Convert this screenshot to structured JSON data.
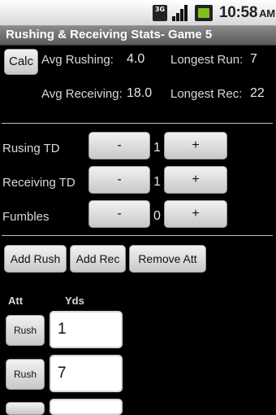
{
  "status_bar": {
    "network": "3G",
    "time": "10:58",
    "ampm": "AM"
  },
  "app": {
    "title": "Rushing & Receiving Stats- Game 5"
  },
  "summary": {
    "calc_label": "Calc",
    "avg_rushing_label": "Avg Rushing:",
    "avg_rushing_value": "4.0",
    "longest_run_label": "Longest Run:",
    "longest_run_value": "7",
    "avg_receiving_label": "Avg Receiving:",
    "avg_receiving_value": "18.0",
    "longest_rec_label": "Longest Rec:",
    "longest_rec_value": "22"
  },
  "counters": [
    {
      "label": "Rusing TD",
      "value": "1",
      "minus": "-",
      "plus": "+"
    },
    {
      "label": "Receiving TD",
      "value": "1",
      "minus": "-",
      "plus": "+"
    },
    {
      "label": "Fumbles",
      "value": "0",
      "minus": "-",
      "plus": "+"
    }
  ],
  "actions": {
    "add_rush": "Add Rush",
    "add_rec": "Add Rec",
    "remove_att": "Remove Att"
  },
  "attempts": {
    "col_att": "Att",
    "col_yds": "Yds",
    "rows": [
      {
        "type": "Rush",
        "yds": "1"
      },
      {
        "type": "Rush",
        "yds": "7"
      },
      {
        "type": "",
        "yds": ""
      }
    ]
  }
}
